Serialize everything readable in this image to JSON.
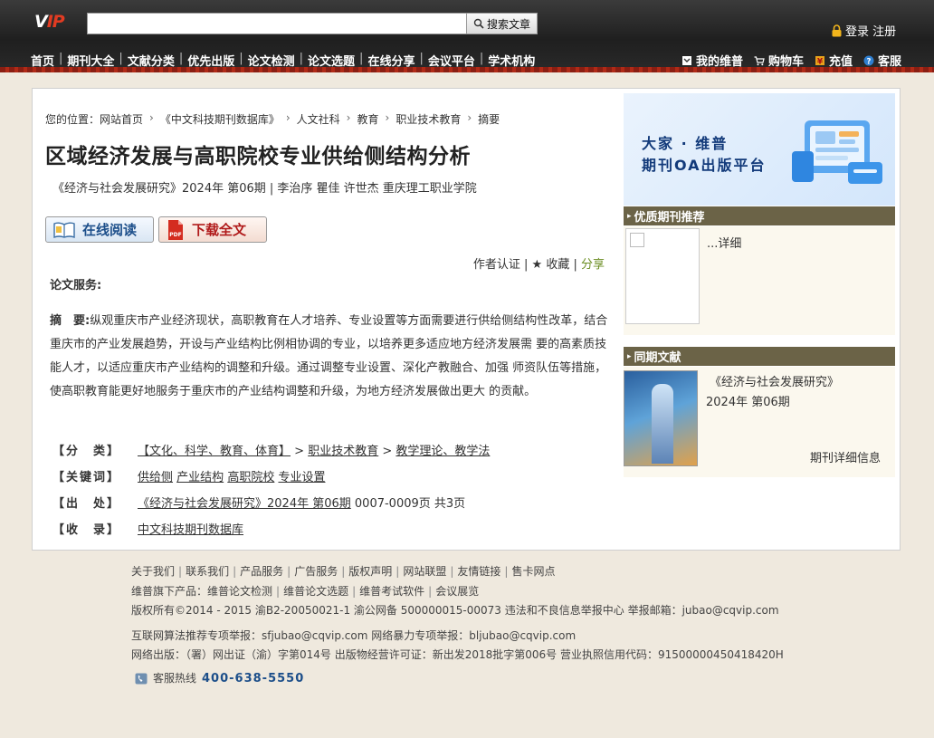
{
  "header": {
    "logo_text": "V",
    "logo_accent": "IP",
    "search_placeholder": "",
    "search_button": "搜索文章",
    "login": "登录 注册",
    "nav": [
      "首页",
      "期刊大全",
      "文献分类",
      "优先出版",
      "论文检测",
      "论文选题",
      "在线分享",
      "会议平台",
      "学术机构"
    ],
    "user_nav": [
      "我的维普",
      "购物车",
      "充值",
      "客服"
    ]
  },
  "breadcrumb": [
    "您的位置：网站首页",
    "《中文科技期刊数据库》",
    "人文社科",
    "教育",
    "职业技术教育",
    "摘要"
  ],
  "article": {
    "title": "区域经济发展与高职院校专业供给侧结构分析",
    "meta": "《经济与社会发展研究》2024年 第06期 | 李治序 瞿佳 许世杰   重庆理工职业学院",
    "read_button": "在线阅读",
    "download_button": "下载全文",
    "actions_auth": "作者认证",
    "actions_fav": "★ 收藏",
    "actions_share": "分享",
    "service_label": "论文服务:",
    "abstract_label": "摘　要:",
    "abstract": "纵观重庆市产业经济现状，高职教育在人才培养、专业设置等方面需要进行供给侧结构性改革，结合重庆市的产业发展趋势，开设与产业结构比例相协调的专业，以培养更多适应地方经济发展需 要的高素质技能人才，以适应重庆市产业结构的调整和升级。通过调整专业设置、深化产教融合、加强 师资队伍等措施，使高职教育能更好地服务于重庆市的产业结构调整和升级，为地方经济发展做出更大 的贡献。",
    "info": {
      "class_key": "【分　类】",
      "class_val1": "【文化、科学、教育、体育】",
      "class_sep1": " > ",
      "class_val2": "职业技术教育",
      "class_sep2": " > ",
      "class_val3": "教学理论、教学法",
      "keywords_key": "【关键词】",
      "keywords": [
        "供给侧",
        "产业结构",
        "高职院校",
        "专业设置"
      ],
      "source_key": "【出　处】",
      "source_link": "《经济与社会发展研究》2024年 第06期",
      "source_pages": " 0007-0009页 共3页",
      "collect_key": "【收　录】",
      "collect_val": "中文科技期刊数据库"
    }
  },
  "sidebar": {
    "banner_line1": "大家 · 维普",
    "banner_line2": "期刊OA出版平台",
    "quality_head": "优质期刊推荐",
    "quality_detail": "...详细",
    "same_head": "同期文献",
    "journal_name": "《经济与社会发展研究》",
    "journal_issue": "2024年 第06期",
    "journal_detail": "期刊详细信息"
  },
  "footer": {
    "links": [
      "关于我们",
      "联系我们",
      "产品服务",
      "广告服务",
      "版权声明",
      "网站联盟",
      "友情链接",
      "售卡网点"
    ],
    "products_label": "维普旗下产品：",
    "products": [
      "维普论文检测",
      "维普论文选题",
      "维普考试软件",
      "会议展览"
    ],
    "copyright": "版权所有©2014 - 2015 渝B2-20050021-1   渝公网备 500000015-00073   违法和不良信息举报中心   举报邮箱：jubao@cqvip.com",
    "report": "互联网算法推荐专项举报：sfjubao@cqvip.com    网络暴力专项举报：bljubao@cqvip.com",
    "license": "网络出版：（署）网出证（渝）字第014号    出版物经营许可证：新出发2018批字第006号    营业执照信用代码：91500000450418420H",
    "hotline_label": "客服热线",
    "hotline_num": "400-638-5550"
  }
}
